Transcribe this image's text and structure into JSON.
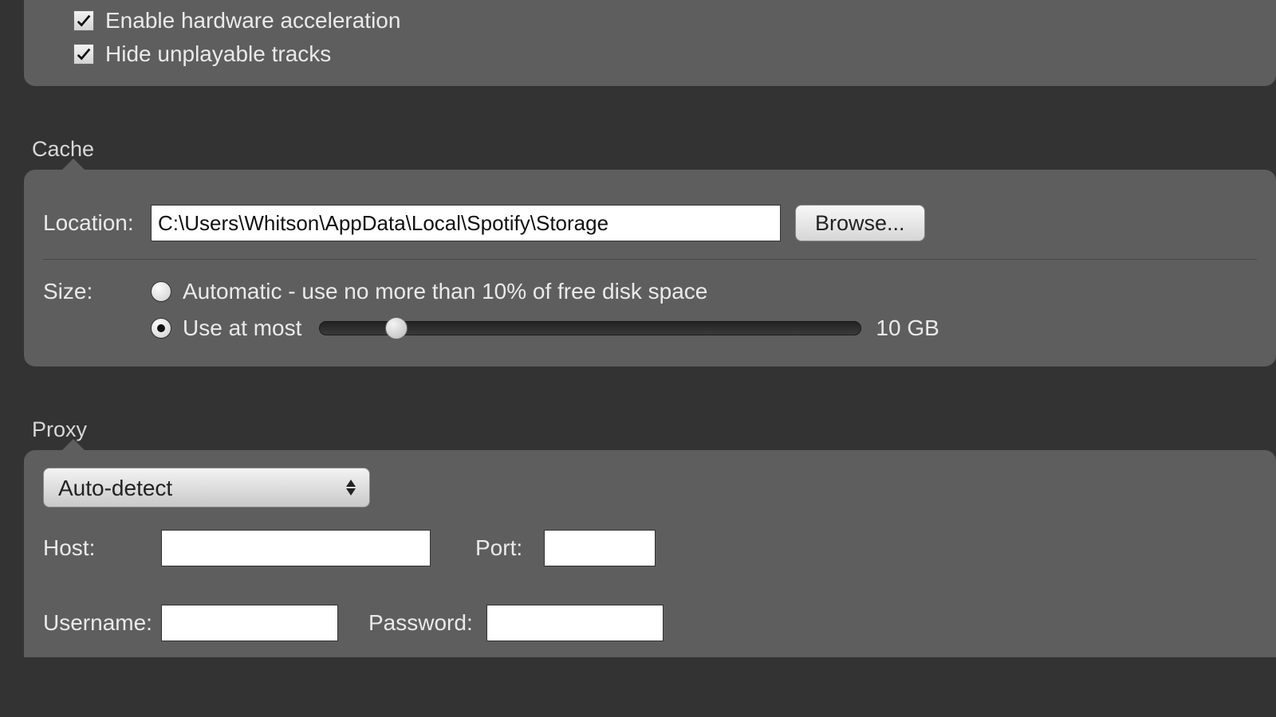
{
  "top_section": {
    "checkboxes": [
      {
        "label": "Enable hardware acceleration",
        "checked": true
      },
      {
        "label": "Hide unplayable tracks",
        "checked": true
      }
    ]
  },
  "cache": {
    "title": "Cache",
    "location_label": "Location:",
    "location_value": "C:\\Users\\Whitson\\AppData\\Local\\Spotify\\Storage",
    "browse_label": "Browse...",
    "size_label": "Size:",
    "auto_label": "Automatic - use no more than 10% of free disk space",
    "at_most_label": "Use at most",
    "size_value": "10 GB",
    "slider_percent": 12,
    "selected": "at_most"
  },
  "proxy": {
    "title": "Proxy",
    "mode_selected": "Auto-detect",
    "host_label": "Host:",
    "host_value": "",
    "port_label": "Port:",
    "port_value": "",
    "username_label": "Username:",
    "username_value": "",
    "password_label": "Password:",
    "password_value": ""
  }
}
